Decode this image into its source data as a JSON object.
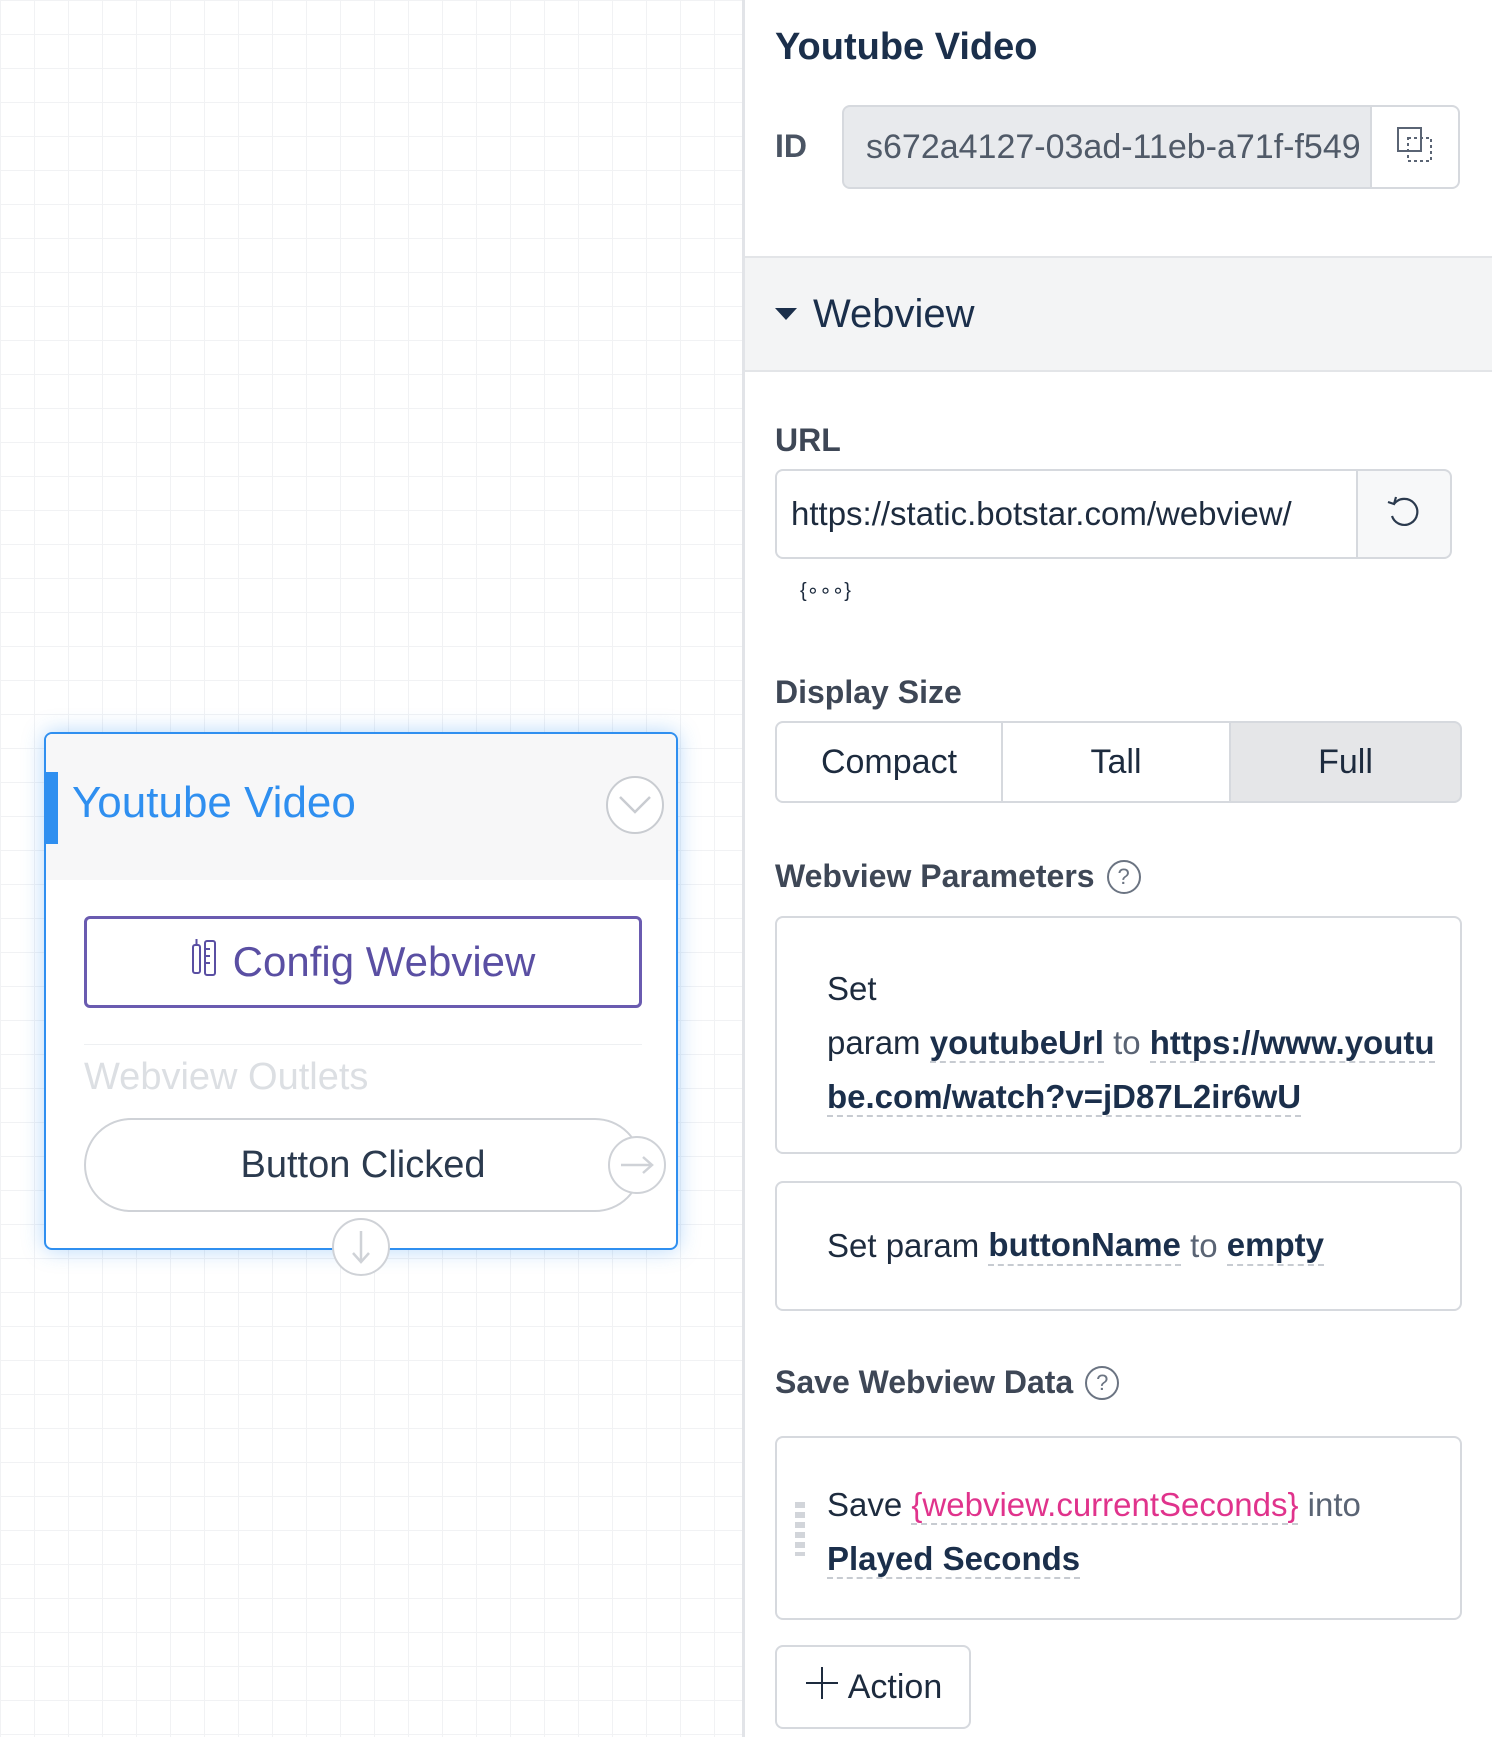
{
  "canvas": {
    "node": {
      "title": "Youtube Video",
      "config_button": "Config Webview",
      "outlets_label": "Webview Outlets",
      "outlet_button": "Button Clicked"
    }
  },
  "panel": {
    "title": "Youtube Video",
    "id_label": "ID",
    "id_value": "s672a4127-03ad-11eb-a71f-f549",
    "section_title": "Webview",
    "url_label": "URL",
    "url_value": "https://static.botstar.com/webview/",
    "variable_icon_text": "{∘∘∘}",
    "display_size_label": "Display Size",
    "display_sizes": [
      "Compact",
      "Tall",
      "Full"
    ],
    "display_size_selected": "Full",
    "params_label": "Webview Parameters",
    "params": [
      {
        "set_word": "Set",
        "param_word": "param",
        "name": "youtubeUrl",
        "to_word": "to",
        "value": "https://www.youtube.com/watch?v=jD87L2ir6wU"
      },
      {
        "prefix": "Set param",
        "name": "buttonName",
        "to_word": "to",
        "value": "empty"
      }
    ],
    "save_label": "Save Webview Data",
    "save_action": {
      "save_word": "Save",
      "variable": "{webview.currentSeconds}",
      "into_word": "into",
      "target": "Played Seconds"
    },
    "add_action_label": "Action",
    "help_icon_glyph": "?"
  },
  "colors": {
    "accent_blue": "#2f8ff0",
    "config_purple": "#6a5bb0",
    "variable_pink": "#e0338c",
    "heading_navy": "#1b2f4b"
  }
}
